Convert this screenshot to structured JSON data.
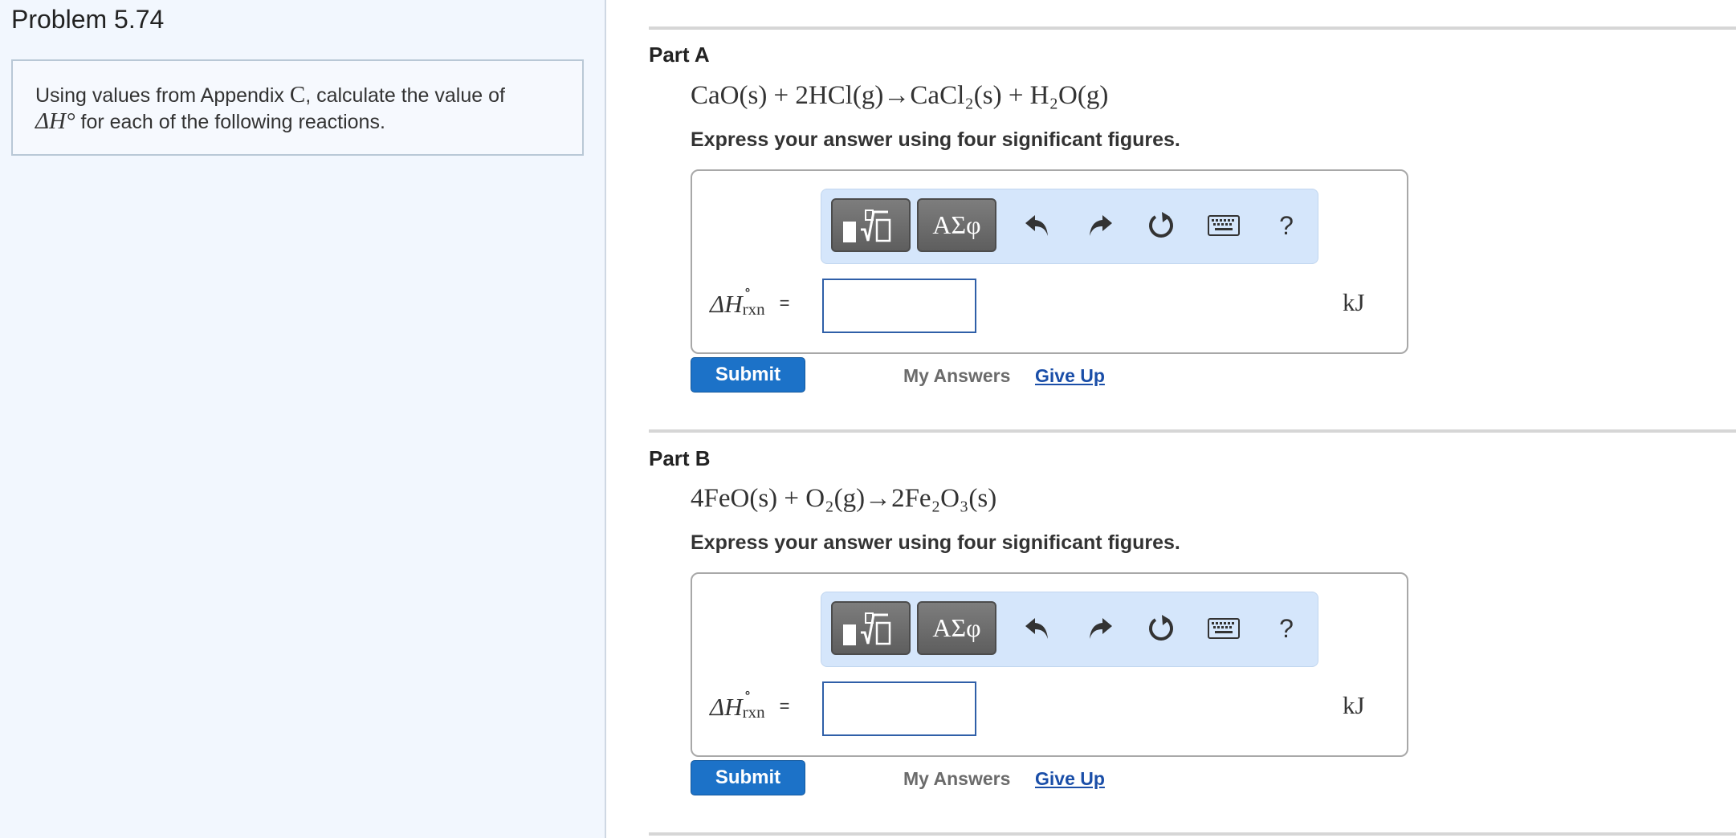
{
  "problem": {
    "title": "Problem 5.74",
    "intro_prefix": "Using values from Appendix ",
    "intro_appendix": "C",
    "intro_middle": ", calculate the value of",
    "intro_quantity": "ΔH°",
    "intro_suffix": " for each of the following reactions."
  },
  "toolbar": {
    "symbols_label": "ΑΣφ",
    "help_label": "?",
    "icons": [
      "templates-icon",
      "undo-icon",
      "redo-icon",
      "reset-icon",
      "keyboard-icon",
      "help-icon"
    ]
  },
  "parts": [
    {
      "label": "Part A",
      "equation": "CaO(s) + 2HCl(g)→CaCl₂(s) + H₂O(g)",
      "instruction": "Express your answer using four significant figures.",
      "answer_var": "ΔH",
      "answer_sup": "∘",
      "answer_sub": "rxn",
      "answer_eq": "=",
      "answer_value": "",
      "units": "kJ",
      "submit_label": "Submit",
      "my_answers_label": "My Answers",
      "give_up_label": "Give Up"
    },
    {
      "label": "Part B",
      "equation": "4FeO(s) + O₂(g)→2Fe₂O₃(s)",
      "instruction": "Express your answer using four significant figures.",
      "answer_var": "ΔH",
      "answer_sup": "∘",
      "answer_sub": "rxn",
      "answer_eq": "=",
      "answer_value": "",
      "units": "kJ",
      "submit_label": "Submit",
      "my_answers_label": "My Answers",
      "give_up_label": "Give Up"
    }
  ],
  "colors": {
    "left_panel_bg": "#f2f7fe",
    "toolbar_bg": "#d5e6fb",
    "submit_bg": "#1c72c8",
    "link": "#1a4ea8",
    "input_border": "#2f5fa8"
  }
}
